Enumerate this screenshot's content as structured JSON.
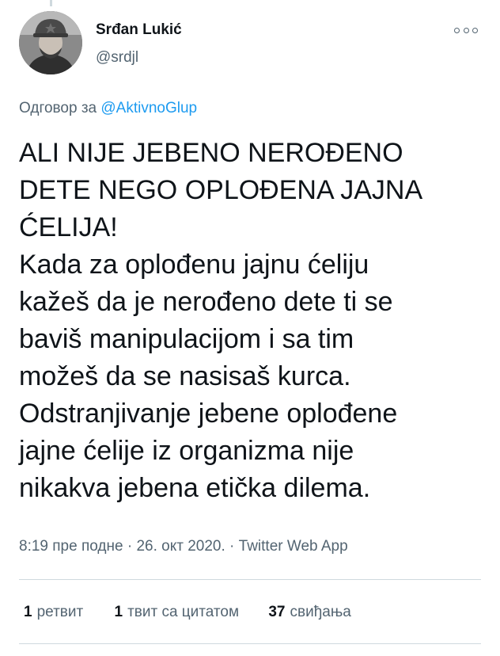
{
  "tweet": {
    "author": {
      "display_name": "Srđan Lukić",
      "handle": "@srdjl",
      "avatar_icon": "user-avatar-photo"
    },
    "reply": {
      "prefix": "Одговор за",
      "mention": "@AktivnoGlup"
    },
    "text": "ALI NIJE JEBENO NEROĐENO\nDETE NEGO OPLOĐENA JAJNA\nĆELIJA!\nKada za oplođenu jajnu ćeliju\nkažeš da je nerođeno dete ti se\nbaviš manipulacijom i sa tim\nmožeš da se nasisaš kurca.\nOdstranjivanje jebene oplođene\njajne ćelije iz organizma nije\nnikakva jebena etička dilema.",
    "time": "8:19 пре подне",
    "date": "26. окт 2020.",
    "separator": "·",
    "source": "Twitter Web App",
    "stats": {
      "retweets_count": "1",
      "retweets_label": "ретвит",
      "quotes_count": "1",
      "quotes_label": "твит са цитатом",
      "likes_count": "37",
      "likes_label": "свиђања"
    },
    "more_icon": "more-options-icon"
  },
  "colors": {
    "text_primary": "#0f1419",
    "text_secondary": "#536471",
    "link": "#1d9bf0",
    "divider": "#cfd9de"
  }
}
